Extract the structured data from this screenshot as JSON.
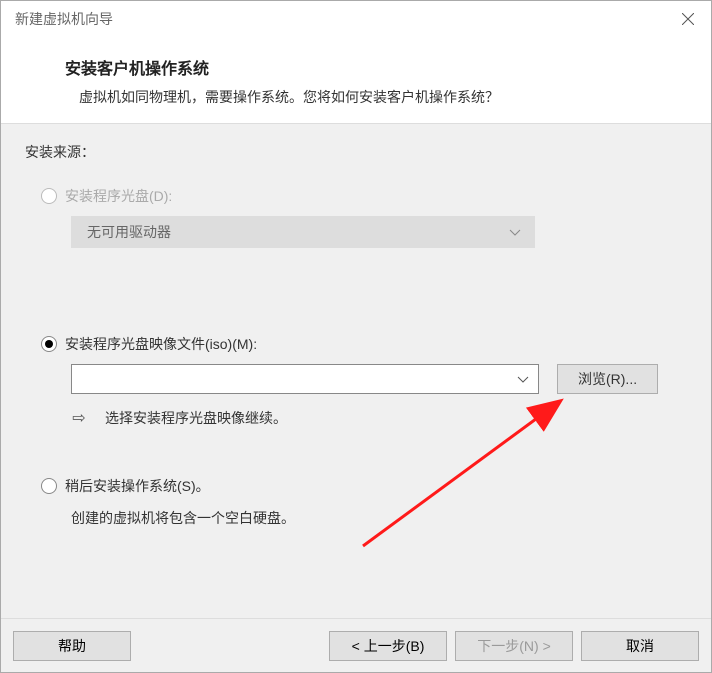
{
  "window": {
    "title": "新建虚拟机向导"
  },
  "header": {
    "title": "安装客户机操作系统",
    "subtitle": "虚拟机如同物理机，需要操作系统。您将如何安装客户机操作系统？"
  },
  "section_label": "安装来源：",
  "options": {
    "disc": {
      "label": "安装程序光盘(D):",
      "dropdown": "无可用驱动器"
    },
    "iso": {
      "label": "安装程序光盘映像文件(iso)(M):",
      "value": "",
      "browse": "浏览(R)...",
      "hint": "选择安装程序光盘映像继续。"
    },
    "later": {
      "label": "稍后安装操作系统(S)。",
      "hint": "创建的虚拟机将包含一个空白硬盘。"
    }
  },
  "buttons": {
    "help": "帮助",
    "back": "< 上一步(B)",
    "next": "下一步(N) >",
    "cancel": "取消"
  }
}
